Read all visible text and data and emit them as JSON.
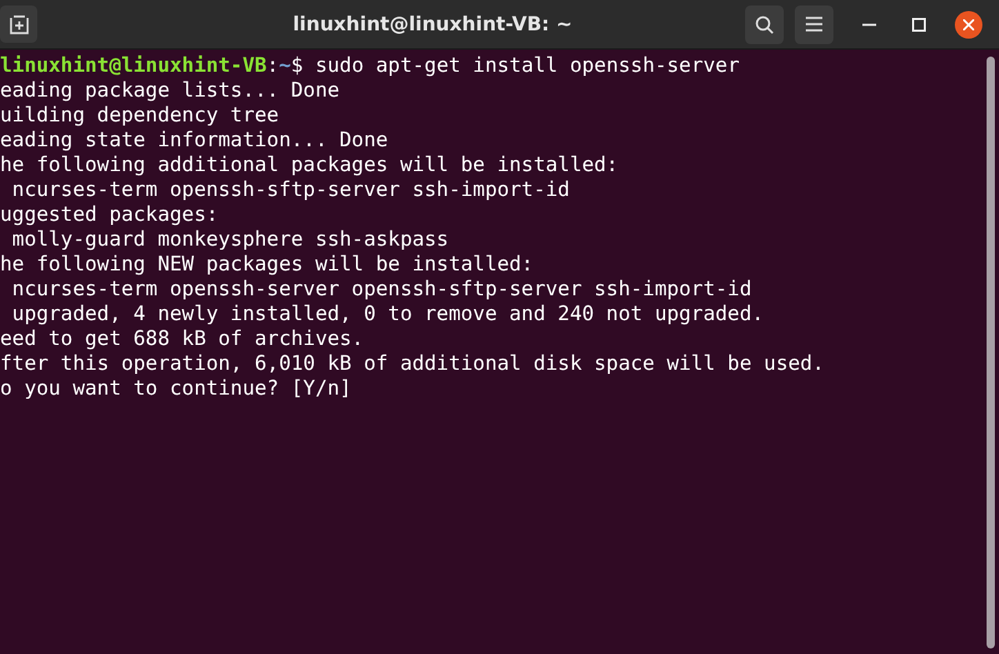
{
  "window": {
    "title": "linuxhint@linuxhint-VB: ~"
  },
  "prompt": {
    "user_host": "linuxhint@linuxhint-VB",
    "separator": ":",
    "path": "~",
    "command": "$ sudo apt-get install openssh-server"
  },
  "output_lines": [
    "eading package lists... Done",
    "uilding dependency tree",
    "eading state information... Done",
    "he following additional packages will be installed:",
    " ncurses-term openssh-sftp-server ssh-import-id",
    "uggested packages:",
    " molly-guard monkeysphere ssh-askpass",
    "he following NEW packages will be installed:",
    " ncurses-term openssh-server openssh-sftp-server ssh-import-id",
    " upgraded, 4 newly installed, 0 to remove and 240 not upgraded.",
    "eed to get 688 kB of archives.",
    "fter this operation, 6,010 kB of additional disk space will be used.",
    "o you want to continue? [Y/n]"
  ]
}
